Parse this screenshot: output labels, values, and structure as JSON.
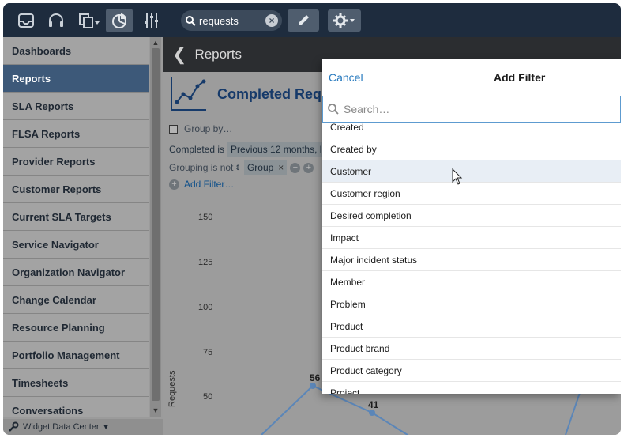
{
  "toolbar": {
    "search_value": "requests",
    "icons": [
      "inbox-icon",
      "headset-icon",
      "copy-icon",
      "pie-chart-icon",
      "sliders-icon",
      "pencil-icon",
      "gear-icon"
    ]
  },
  "sidebar": {
    "items": [
      {
        "label": "Dashboards",
        "active": false
      },
      {
        "label": "Reports",
        "active": true
      },
      {
        "label": "SLA Reports",
        "active": false
      },
      {
        "label": "FLSA Reports",
        "active": false
      },
      {
        "label": "Provider Reports",
        "active": false
      },
      {
        "label": "Customer Reports",
        "active": false
      },
      {
        "label": "Current SLA Targets",
        "active": false
      },
      {
        "label": "Service Navigator",
        "active": false
      },
      {
        "label": "Organization Navigator",
        "active": false
      },
      {
        "label": "Change Calendar",
        "active": false
      },
      {
        "label": "Resource Planning",
        "active": false
      },
      {
        "label": "Portfolio Management",
        "active": false
      },
      {
        "label": "Timesheets",
        "active": false
      },
      {
        "label": "Conversations",
        "active": false
      }
    ],
    "widget_label": "Widget Data Center"
  },
  "main": {
    "header_title": "Reports",
    "report_title": "Completed Req",
    "group_by_label": "Group by…",
    "completed_label": "Completed is",
    "completed_value": "Previous 12 months, l",
    "grouping_label": "Grouping is not",
    "grouping_value": "Group",
    "add_filter_label": "Add Filter…"
  },
  "chart_data": {
    "type": "line",
    "ylabel": "Requests",
    "yticks": [
      150,
      125,
      100,
      75,
      50
    ],
    "points": [
      {
        "label": "56",
        "value": 56
      },
      {
        "label": "41",
        "value": 41
      }
    ]
  },
  "modal": {
    "cancel_label": "Cancel",
    "title": "Add Filter",
    "search_placeholder": "Search…",
    "options": [
      "Created",
      "Created by",
      "Customer",
      "Customer region",
      "Desired completion",
      "Impact",
      "Major incident status",
      "Member",
      "Problem",
      "Product",
      "Product brand",
      "Product category",
      "Project"
    ],
    "hovered_option": "Customer"
  }
}
